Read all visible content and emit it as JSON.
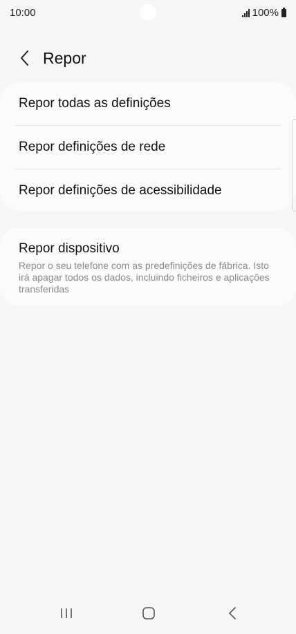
{
  "status_bar": {
    "time": "10:00",
    "battery": "100%"
  },
  "header": {
    "back_icon": "chevron-left-icon",
    "title": "Repor"
  },
  "reset_options": [
    {
      "label": "Repor todas as definições"
    },
    {
      "label": "Repor definições de rede"
    },
    {
      "label": "Repor definições de acessibilidade"
    }
  ],
  "device_reset": {
    "title": "Repor dispositivo",
    "description": "Repor o seu telefone com as predefinições de fábrica. Isto irá apagar todos os dados, incluindo ficheiros e aplicações transferidas"
  },
  "nav_bar": {
    "recents_icon": "recent-apps-icon",
    "home_icon": "home-icon",
    "back_icon": "back-icon"
  },
  "colors": {
    "background": "#f6f6f6",
    "card": "#fbfbfb",
    "text_primary": "#111111",
    "text_secondary": "#8a8a8a"
  }
}
